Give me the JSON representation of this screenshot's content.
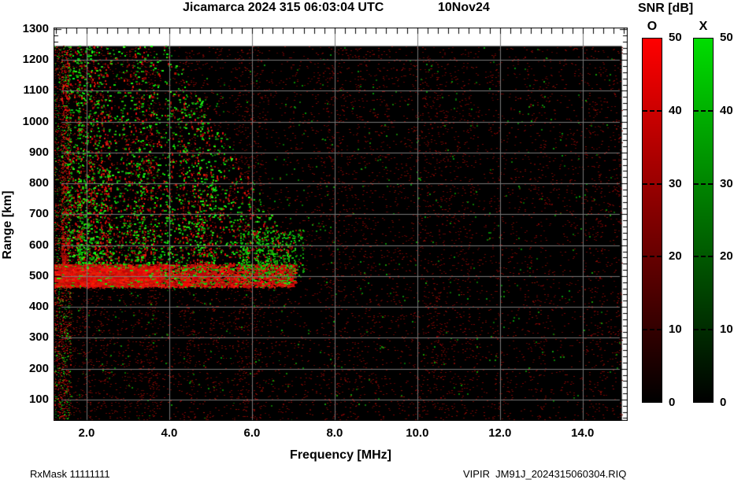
{
  "title": {
    "main": "Jicamarca 2024 315 06:03:04 UTC",
    "date": "10Nov24"
  },
  "footer": {
    "left": "RxMask 11111111",
    "right": "VIPIR  JM91J_2024315060304.RIQ"
  },
  "chart_data": {
    "type": "heatmap",
    "title": "Jicamarca 2024 315 06:03:04 UTC",
    "date_label": "10Nov24",
    "xlabel": "Frequency [MHz]",
    "ylabel": "Range [km]",
    "xlim": [
      1.2,
      15.09
    ],
    "ylim": [
      31,
      1305
    ],
    "x_ticks": {
      "values": [
        2,
        4,
        6,
        8,
        10,
        12,
        14
      ],
      "labels": [
        "2.0",
        "4.0",
        "6.0",
        "8.0",
        "10.0",
        "12.0",
        "14.0"
      ]
    },
    "y_ticks": {
      "values": [
        100,
        200,
        300,
        400,
        500,
        600,
        700,
        800,
        900,
        1000,
        1100,
        1200,
        1300
      ],
      "labels": [
        "100",
        "200",
        "300",
        "400",
        "500",
        "600",
        "700",
        "800",
        "900",
        "1000",
        "1100",
        "1200",
        "1300"
      ]
    },
    "grid": true,
    "grid_color": "#787878",
    "plot_bg": "#000000",
    "data_extent": {
      "f": [
        1.2,
        14.95
      ],
      "r": [
        33,
        1245
      ]
    },
    "colorbar": {
      "title": "SNR [dB]",
      "range": [
        0,
        50
      ],
      "tick_values": [
        50,
        40,
        30,
        20,
        10,
        0
      ],
      "tick_labels": [
        "50",
        "40",
        "30",
        "20",
        "10",
        "0"
      ],
      "bars": [
        {
          "label": "O",
          "top_color": "#ff0000"
        },
        {
          "label": "X",
          "top_color": "#00dd00"
        }
      ]
    },
    "regions": [
      {
        "name": "background-faint-red-noise",
        "f": [
          1.2,
          14.95
        ],
        "r": [
          33,
          1243
        ],
        "n": 16000,
        "w": [
          2,
          3
        ],
        "h": [
          1,
          1
        ],
        "green": 0,
        "b": [
          0.12,
          0.42
        ],
        "streak": 0.65,
        "fBias": 1.1,
        "rBias": 1
      },
      {
        "name": "background-sparse-green-dots",
        "f": [
          1.3,
          14.9
        ],
        "r": [
          80,
          1243
        ],
        "n": 620,
        "w": [
          2,
          3
        ],
        "h": [
          2,
          3
        ],
        "green": 1,
        "b": [
          0.22,
          0.5
        ],
        "streak": 0.35
      },
      {
        "name": "left-edge-echo-column",
        "f": [
          1.2,
          1.62
        ],
        "r": [
          33,
          1245
        ],
        "n": 2000,
        "w": [
          1,
          3
        ],
        "h": [
          1,
          2
        ],
        "green": 0.32,
        "b": [
          0.25,
          0.95
        ]
      },
      {
        "name": "spread-F-cloud-red-streaks",
        "f": [
          1.4,
          7.0
        ],
        "r": [
          465,
          1250
        ],
        "n": 5600,
        "w": [
          2,
          3
        ],
        "h": [
          2,
          4
        ],
        "green": 0.04,
        "b": [
          0.28,
          0.9
        ],
        "streak": 0.85,
        "fBias": 1.45,
        "rBias": 2.1,
        "taper": {
          "f0": 4,
          "slope": 220,
          "rmax": 1250
        }
      },
      {
        "name": "spread-F-cloud-green",
        "f": [
          1.5,
          6.9
        ],
        "r": [
          475,
          1250
        ],
        "n": 5600,
        "w": [
          2,
          4
        ],
        "h": [
          2,
          3
        ],
        "green": 0.96,
        "b": [
          0.32,
          1.0
        ],
        "streak": 0.75,
        "fBias": 1.3,
        "rBias": 1.9,
        "taper": {
          "f0": 4,
          "slope": 220,
          "rmax": 1250
        }
      },
      {
        "name": "bright-echo-band-500km",
        "f": [
          1.2,
          7.05
        ],
        "r": [
          465,
          538
        ],
        "n": 5200,
        "w": [
          2,
          5
        ],
        "h": [
          1,
          3
        ],
        "green": 0.15,
        "b": [
          0.5,
          1.0
        ],
        "fBias": 1.55
      },
      {
        "name": "solid-red-band-left",
        "f": [
          1.2,
          3.7
        ],
        "r": [
          468,
          526
        ],
        "n": 2800,
        "w": [
          3,
          6
        ],
        "h": [
          2,
          3
        ],
        "green": 0.07,
        "b": [
          0.62,
          1.0
        ]
      },
      {
        "name": "below-band-sparse-noise",
        "f": [
          1.2,
          7.0
        ],
        "r": [
          33,
          462
        ],
        "n": 800,
        "w": [
          1,
          3
        ],
        "h": [
          1,
          2
        ],
        "green": 0.12,
        "b": [
          0.18,
          0.55
        ],
        "streak": 0.8,
        "fBias": 1.7
      },
      {
        "name": "green-fringe-600km",
        "f": [
          5.7,
          7.25
        ],
        "r": [
          495,
          650
        ],
        "n": 380,
        "w": [
          2,
          3
        ],
        "h": [
          2,
          3
        ],
        "green": 0.85,
        "b": [
          0.3,
          0.85
        ]
      }
    ]
  }
}
